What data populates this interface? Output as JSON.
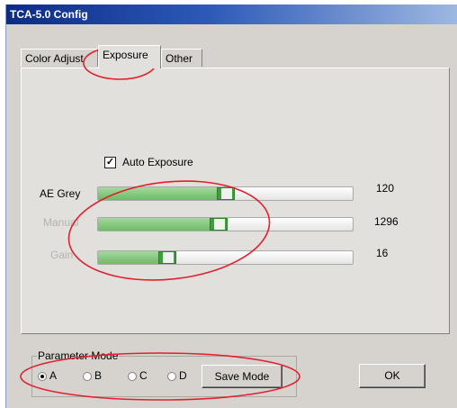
{
  "window": {
    "title": "TCA-5.0 Config"
  },
  "tabs": [
    {
      "label": "Color Adjust",
      "active": false
    },
    {
      "label": "Exposure",
      "active": true
    },
    {
      "label": "Other",
      "active": false
    }
  ],
  "exposure": {
    "auto_exposure": {
      "label": "Auto Exposure",
      "checked": true,
      "check_glyph": "✓"
    },
    "sliders": [
      {
        "label": "AE Grey",
        "value": "120",
        "level": 0.45,
        "enabled": true
      },
      {
        "label": "Manual",
        "value": "1296",
        "level": 0.42,
        "enabled": false
      },
      {
        "label": "Gain",
        "value": "16",
        "level": 0.2,
        "enabled": false
      }
    ]
  },
  "parameter_mode": {
    "title": "Parameter Mode",
    "options": [
      {
        "label": "A",
        "selected": true
      },
      {
        "label": "B",
        "selected": false
      },
      {
        "label": "C",
        "selected": false
      },
      {
        "label": "D",
        "selected": false
      }
    ],
    "save_label": "Save Mode"
  },
  "ok_label": "OK",
  "colors": {
    "annotation": "#e0212f",
    "accent_green": "#6cbc66",
    "title_bar": "#0b2b86"
  }
}
